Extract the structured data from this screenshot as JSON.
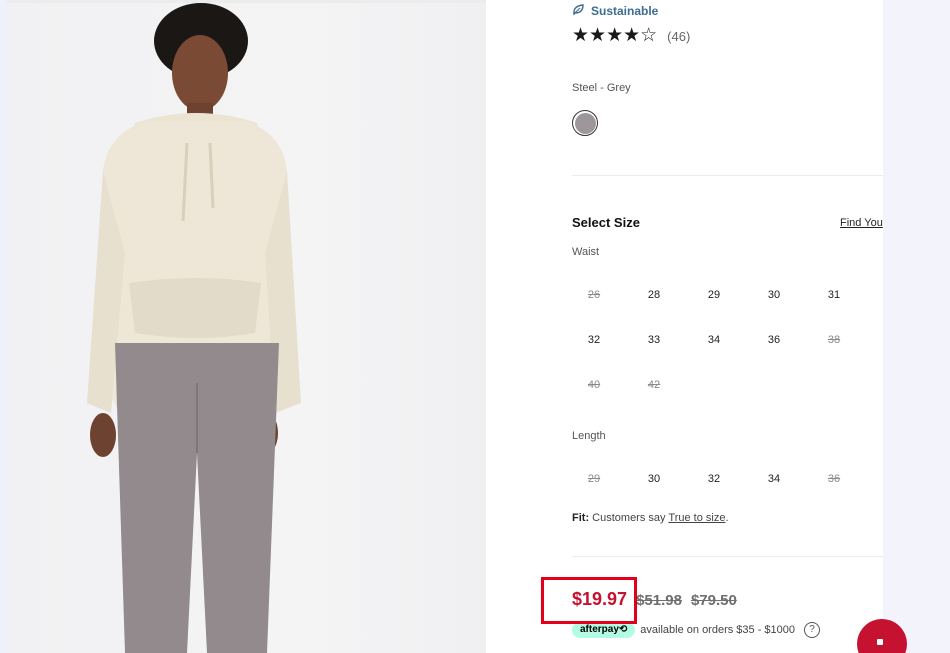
{
  "product": {
    "sustainable_label": "Sustainable",
    "rating_stars": "★★★★☆",
    "review_count": "(46)",
    "color_name": "Steel - Grey",
    "swatch_color": "#9d969a"
  },
  "size_selector": {
    "title": "Select Size",
    "guide_link": "Find You",
    "waist_label": "Waist",
    "waist_sizes": [
      {
        "label": "26",
        "available": false
      },
      {
        "label": "28",
        "available": true
      },
      {
        "label": "29",
        "available": true
      },
      {
        "label": "30",
        "available": true
      },
      {
        "label": "31",
        "available": true
      },
      {
        "label": "32",
        "available": true
      },
      {
        "label": "33",
        "available": true
      },
      {
        "label": "34",
        "available": true
      },
      {
        "label": "36",
        "available": true
      },
      {
        "label": "38",
        "available": false
      },
      {
        "label": "40",
        "available": false
      },
      {
        "label": "42",
        "available": false
      }
    ],
    "length_label": "Length",
    "length_sizes": [
      {
        "label": "29",
        "available": false
      },
      {
        "label": "30",
        "available": true
      },
      {
        "label": "32",
        "available": true
      },
      {
        "label": "34",
        "available": true
      },
      {
        "label": "36",
        "available": false
      }
    ],
    "fit_label": "Fit:",
    "fit_text": " Customers say ",
    "fit_link": "True to size",
    "fit_end": "."
  },
  "pricing": {
    "sale_price": "$19.97",
    "was_price_1": "$51.98",
    "was_price_2": "$79.50",
    "afterpay_badge": "afterpay⟲",
    "afterpay_text": "available on orders $35 - $1000",
    "help_glyph": "?",
    "sale_color": "#c41230"
  },
  "colors": {
    "accent": "#c41230",
    "highlight": "#e4001b",
    "afterpay": "#b2fce4"
  }
}
